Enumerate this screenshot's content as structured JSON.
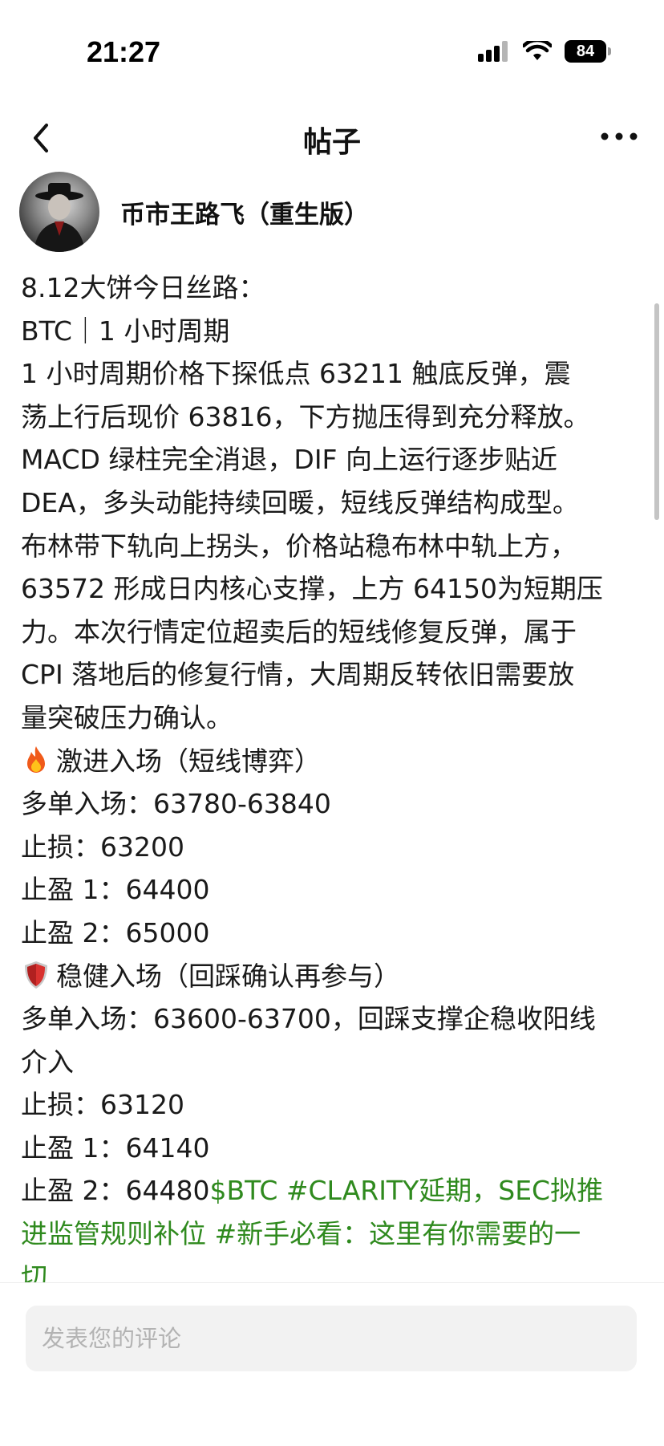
{
  "status_bar": {
    "time": "21:27",
    "battery": "84",
    "icons": [
      "signal-icon",
      "wifi-icon",
      "battery-icon"
    ]
  },
  "nav": {
    "title": "帖子",
    "back_icon": "chevron-left-icon",
    "more_icon": "more-horizontal-icon"
  },
  "author": {
    "name": "币市王路飞（重生版）"
  },
  "post": {
    "lines": [
      "8.12大饼今日丝路：",
      "BTC｜1 小时周期",
      "1 小时周期价格下探低点 63211 触底反弹，震",
      "荡上行后现价 63816，下方抛压得到充分释放。",
      "MACD 绿柱完全消退，DIF 向上运行逐步贴近",
      "DEA，多头动能持续回暖，短线反弹结构成型。",
      "布林带下轨向上拐头，价格站稳布林中轨上方，",
      "63572 形成日内核心支撑，上方 64150为短期压",
      "力。本次行情定位超卖后的短线修复反弹，属于",
      "CPI 落地后的修复行情，大周期反转依旧需要放",
      "量突破压力确认。",
      "激进入场（短线博弈）",
      "多单入场：63780-63840",
      "止损：63200",
      "止盈 1：64400",
      "止盈 2：65000",
      "稳健入场（回踩确认再参与）",
      "多单入场：63600-63700，回踩支撑企稳收阳线",
      "介入",
      "止损：63120",
      "止盈 1：64140",
      "止盈 2：64480",
      "$BTC #CLARITY延期，SEC拟推",
      "进监管规则补位 #新手必看：这里有你需要的一",
      "切"
    ],
    "section_icons": [
      "fire-icon",
      "shield-icon"
    ],
    "tag_color": "#2f8a1e"
  },
  "comment": {
    "placeholder": "发表您的评论"
  }
}
